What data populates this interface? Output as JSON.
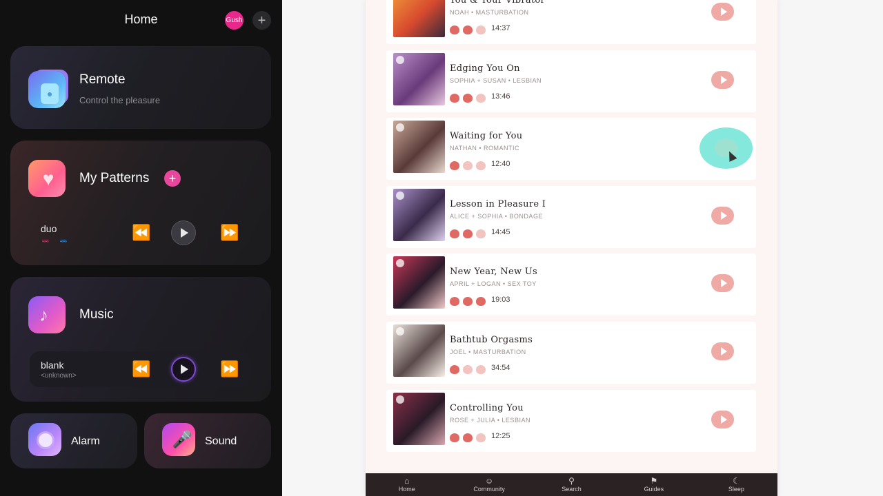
{
  "left": {
    "title": "Home",
    "badge": "Gush",
    "add_icon": "+",
    "remote": {
      "title": "Remote",
      "subtitle": "Control the pleasure"
    },
    "patterns": {
      "title": "My Patterns",
      "add": "+",
      "track": "duo",
      "wave_a": "≈≈",
      "wave_b": "≈≈"
    },
    "music": {
      "title": "Music",
      "track": "blank",
      "artist": "<unknown>"
    },
    "alarm": {
      "title": "Alarm"
    },
    "sound": {
      "title": "Sound"
    },
    "controls": {
      "prev": "⏪",
      "next": "⏩"
    }
  },
  "stories": [
    {
      "title": "You & Your Vibrator",
      "meta": "NOAH • MASTURBATION",
      "heat": 2,
      "duration": "14:37",
      "thumb_colors": [
        "#f2a23a",
        "#d84a2e",
        "#3a2a3a"
      ]
    },
    {
      "title": "Edging You On",
      "meta": "SOPHIA + SUSAN • LESBIAN",
      "heat": 2,
      "duration": "13:46",
      "thumb_colors": [
        "#b890c8",
        "#6a3a7a",
        "#e8c8e0"
      ]
    },
    {
      "title": "Waiting for You",
      "meta": "NATHAN • ROMANTIC",
      "heat": 1,
      "duration": "12:40",
      "thumb_colors": [
        "#c8a898",
        "#5a3a38",
        "#e8d8d0"
      ]
    },
    {
      "title": "Lesson in Pleasure I",
      "meta": "ALICE + SOPHIA • BONDAGE",
      "heat": 2,
      "duration": "14:45",
      "thumb_colors": [
        "#a890c8",
        "#3a2a4a",
        "#e0d0f0"
      ]
    },
    {
      "title": "New Year, New Us",
      "meta": "APRIL + LOGAN • SEX TOY",
      "heat": 3,
      "duration": "19:03",
      "thumb_colors": [
        "#c83858",
        "#2a1a2a",
        "#f0c8c8"
      ]
    },
    {
      "title": "Bathtub Orgasms",
      "meta": "JOEL • MASTURBATION",
      "heat": 1,
      "duration": "34:54",
      "thumb_colors": [
        "#e8e0d8",
        "#5a4a4a",
        "#f8f0e8"
      ]
    },
    {
      "title": "Controlling You",
      "meta": "ROSE + JULIA • LESBIAN",
      "heat": 2,
      "duration": "12:25",
      "thumb_colors": [
        "#8a3048",
        "#2a1a28",
        "#d8a8b0"
      ]
    }
  ],
  "nav": [
    {
      "label": "Home",
      "icon": "⌂"
    },
    {
      "label": "Community",
      "icon": "☺"
    },
    {
      "label": "Search",
      "icon": "⚲"
    },
    {
      "label": "Guides",
      "icon": "⚑"
    },
    {
      "label": "Sleep",
      "icon": "☾"
    }
  ],
  "colors": {
    "accent_pink": "#e8288a",
    "play_button": "#f0aaa5",
    "hover_highlight": "#6fe6d6",
    "heat_on": "#e06a63",
    "heat_off": "#f2c4c0"
  }
}
